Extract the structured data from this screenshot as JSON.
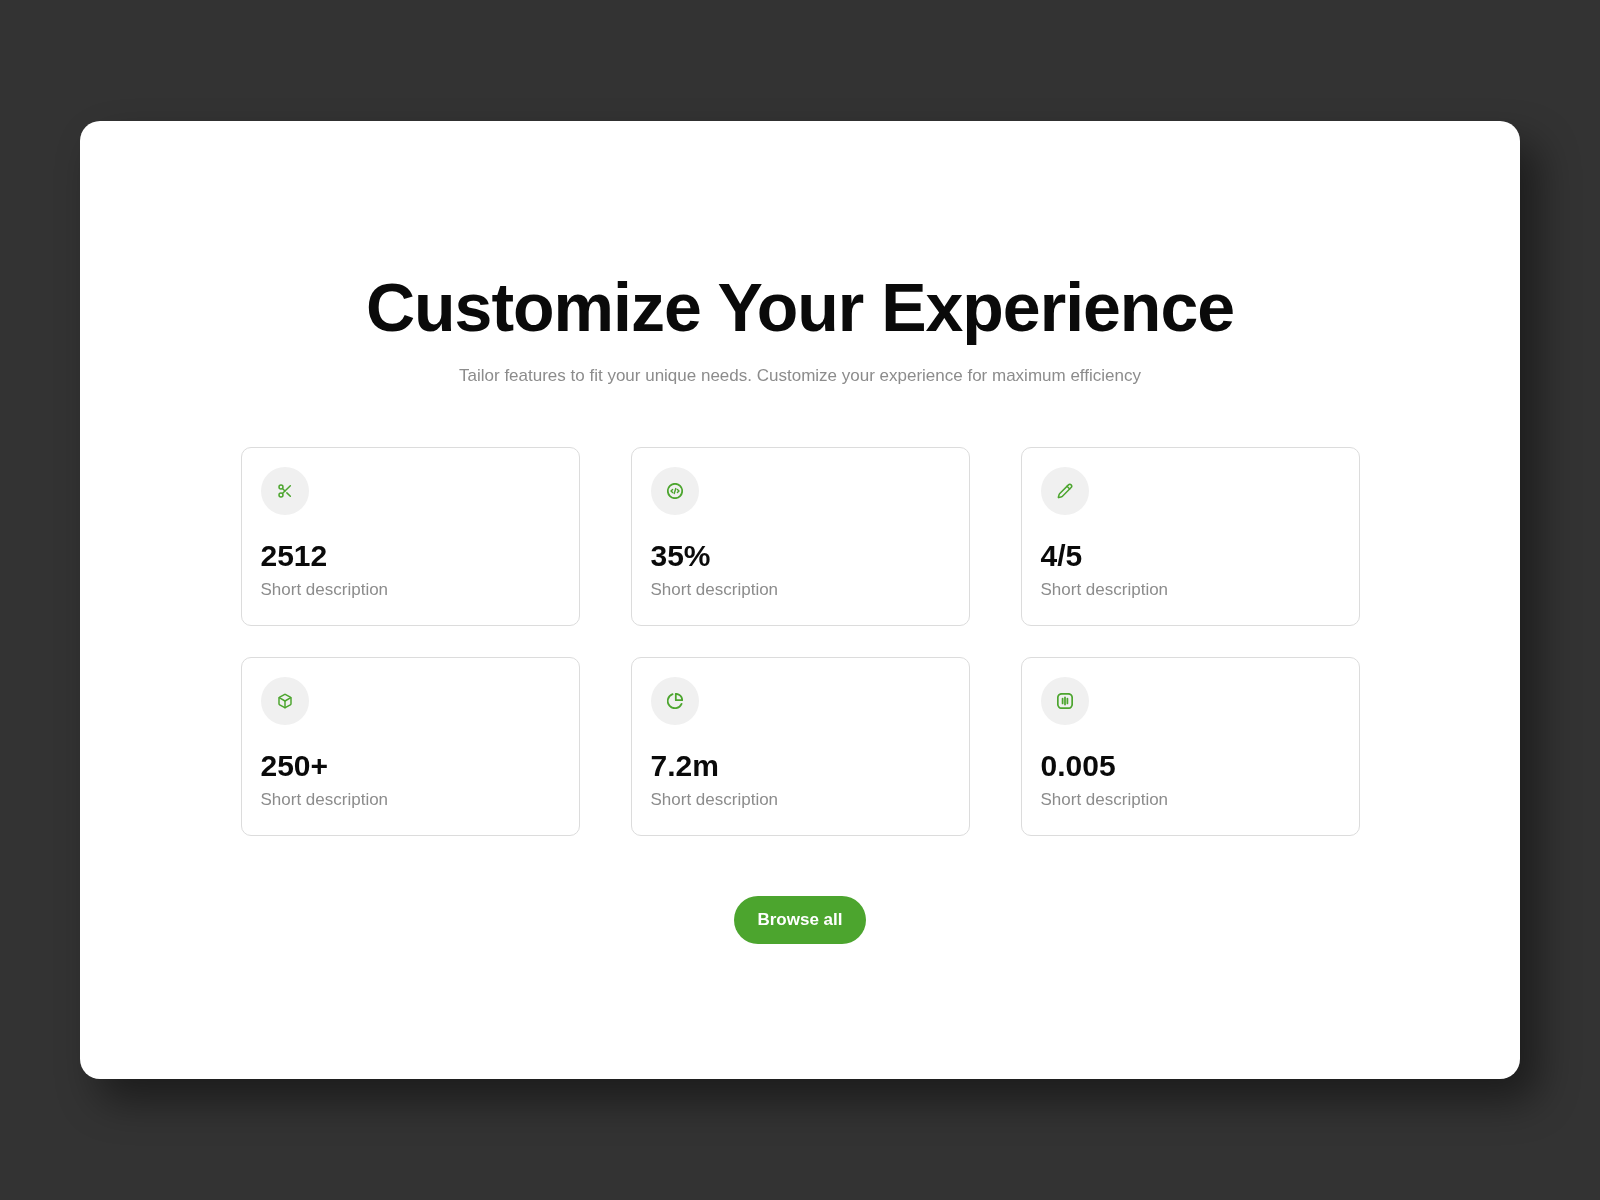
{
  "heading": {
    "title": "Customize Your Experience",
    "subtitle": "Tailor features to fit your unique needs. Customize your experience for maximum efficiency"
  },
  "stats": [
    {
      "kind": "scissors",
      "value": "2512",
      "description": "Short description"
    },
    {
      "kind": "code",
      "value": "35%",
      "description": "Short description"
    },
    {
      "kind": "pencil",
      "value": "4/5",
      "description": "Short description"
    },
    {
      "kind": "box",
      "value": "250+",
      "description": "Short description"
    },
    {
      "kind": "pie",
      "value": "7.2m",
      "description": "Short description"
    },
    {
      "kind": "audio",
      "value": "0.005",
      "description": "Short description"
    }
  ],
  "button": {
    "label": "Browse all"
  }
}
